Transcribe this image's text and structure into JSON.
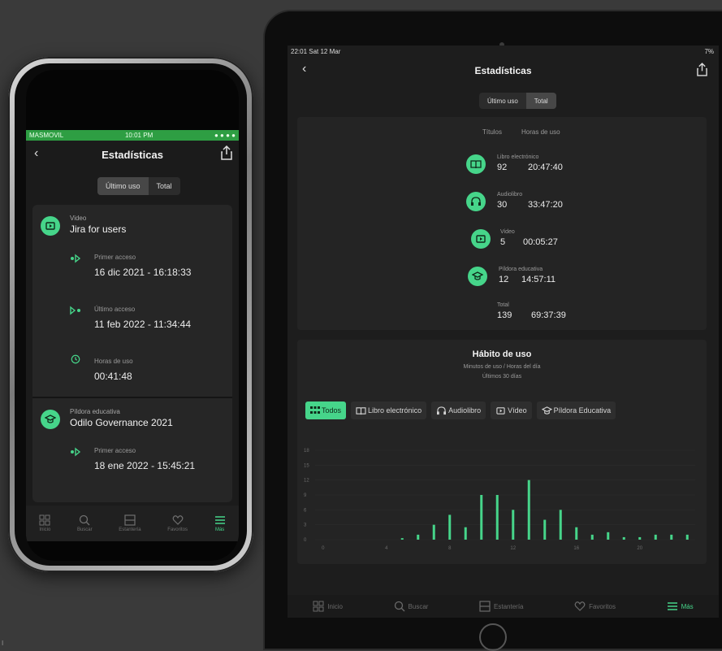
{
  "colors": {
    "accent": "#46d58a",
    "carrier_bar": "#2e9e43",
    "background": "#1b1b1b"
  },
  "phone": {
    "status": {
      "carrier": "MASMOVIL",
      "time": "10:01 PM"
    },
    "nav_title": "Estadísticas",
    "segments": [
      "Último uso",
      "Total"
    ],
    "active_segment": "Último uso",
    "items": [
      {
        "category": "Video",
        "title": "Jira for users",
        "icon": "video-icon",
        "rows": [
          {
            "label": "Primer acceso",
            "value": "16 dic 2021 - 16:18:33",
            "icon": "first-access-icon"
          },
          {
            "label": "Último acceso",
            "value": "11 feb 2022 - 11:34:44",
            "icon": "last-access-icon"
          },
          {
            "label": "Horas de uso",
            "value": "00:41:48",
            "icon": "clock-icon"
          }
        ]
      },
      {
        "category": "Píldora educativa",
        "title": "Odilo Governance 2021",
        "icon": "graduation-cap-icon",
        "rows": [
          {
            "label": "Primer acceso",
            "value": "18 ene 2022 - 15:45:21",
            "icon": "first-access-icon"
          }
        ]
      }
    ],
    "tabs": [
      "Inicio",
      "Buscar",
      "Estantería",
      "Favoritos",
      "Más"
    ],
    "active_tab": "Más"
  },
  "tablet": {
    "status": {
      "time": "22:01  Sat 12 Mar",
      "battery": "7%"
    },
    "nav_title": "Estadísticas",
    "segments": [
      "Último uso",
      "Total"
    ],
    "active_segment": "Total",
    "columns": [
      "Títulos",
      "Horas de uso"
    ],
    "stats": [
      {
        "category": "Libro electrónico",
        "titles": "92",
        "hours": "20:47:40",
        "icon": "book-icon"
      },
      {
        "category": "Audiolibro",
        "titles": "30",
        "hours": "33:47:20",
        "icon": "headphones-icon"
      },
      {
        "category": "Video",
        "titles": "5",
        "hours": "00:05:27",
        "icon": "video-icon"
      },
      {
        "category": "Píldora educativa",
        "titles": "12",
        "hours": "14:57:11",
        "icon": "graduation-cap-icon"
      }
    ],
    "total": {
      "label": "Total",
      "titles": "139",
      "hours": "69:37:39"
    },
    "habit": {
      "title": "Hábito de uso",
      "subtitle": "Minutos de uso / Horas del día",
      "period": "Últimos 30 días"
    },
    "filters": [
      "Todos",
      "Libro electrónico",
      "Audiolibro",
      "Vídeo",
      "Píldora Educativa"
    ],
    "active_filter": "Todos",
    "tabs": [
      "Inicio",
      "Buscar",
      "Estantería",
      "Favoritos",
      "Más"
    ],
    "active_tab": "Más"
  },
  "chart_data": {
    "type": "bar",
    "y_tick_labels": [
      "0",
      "3",
      "6",
      "9",
      "12",
      "15",
      "18"
    ],
    "x_tick_labels": [
      "0",
      "4",
      "8",
      "12",
      "16",
      "20"
    ],
    "ylim": [
      0,
      18
    ],
    "x": [
      0,
      1,
      2,
      3,
      4,
      5,
      6,
      7,
      8,
      9,
      10,
      11,
      12,
      13,
      14,
      15,
      16,
      17,
      18,
      19,
      20,
      21,
      22,
      23
    ],
    "values": [
      0,
      0,
      0,
      0,
      0,
      0.3,
      1,
      3,
      5,
      2.5,
      9,
      9,
      6,
      12,
      4,
      6,
      2.5,
      1,
      1.5,
      0.5,
      0.5,
      1,
      1,
      1
    ]
  },
  "corner_mark": "I"
}
